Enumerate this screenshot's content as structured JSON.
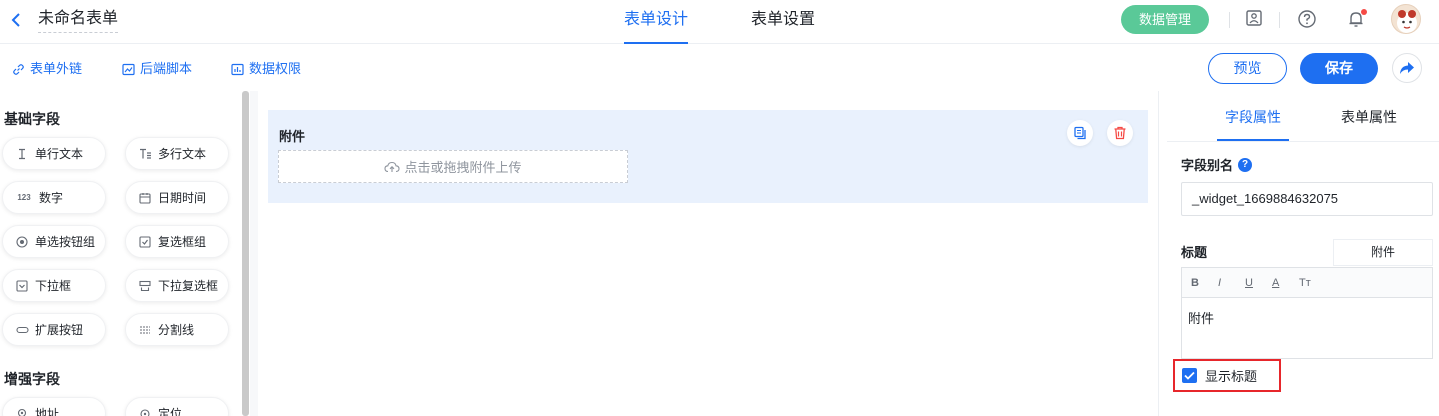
{
  "header": {
    "form_name": "未命名表单",
    "tabs": [
      {
        "label": "表单设计",
        "active": true
      },
      {
        "label": "表单设置",
        "active": false
      }
    ],
    "data_manage_label": "数据管理",
    "icons": [
      "contacts-icon",
      "help-icon",
      "bell-icon",
      "avatar"
    ]
  },
  "toolbar": {
    "links": [
      {
        "label": "表单外链",
        "icon": "link-icon"
      },
      {
        "label": "后端脚本",
        "icon": "script-icon"
      },
      {
        "label": "数据权限",
        "icon": "permission-icon"
      }
    ],
    "preview_label": "预览",
    "save_label": "保存"
  },
  "left_panel": {
    "basic_title": "基础字段",
    "basic_fields": [
      {
        "label": "单行文本",
        "icon": "text-cursor-icon"
      },
      {
        "label": "多行文本",
        "icon": "multiline-text-icon"
      },
      {
        "label": "数字",
        "icon": "number-icon"
      },
      {
        "label": "日期时间",
        "icon": "calendar-icon"
      },
      {
        "label": "单选按钮组",
        "icon": "radio-icon"
      },
      {
        "label": "复选框组",
        "icon": "checkbox-icon"
      },
      {
        "label": "下拉框",
        "icon": "dropdown-icon"
      },
      {
        "label": "下拉复选框",
        "icon": "dropdown-multi-icon"
      },
      {
        "label": "扩展按钮",
        "icon": "link-button-icon"
      },
      {
        "label": "分割线",
        "icon": "divider-icon"
      }
    ],
    "enhanced_title": "增强字段",
    "enhanced_fields": [
      {
        "label": "地址",
        "icon": "location-pin-icon"
      },
      {
        "label": "定位",
        "icon": "locate-icon"
      }
    ]
  },
  "canvas": {
    "widget_label": "附件",
    "upload_text": "点击或拖拽附件上传"
  },
  "right_panel": {
    "tabs": [
      {
        "label": "字段属性",
        "active": true
      },
      {
        "label": "表单属性",
        "active": false
      }
    ],
    "alias_label": "字段别名",
    "alias_value": "_widget_1669884632075",
    "title_label": "标题",
    "title_mini": "附件",
    "editor_buttons": [
      "B",
      "I",
      "U",
      "A",
      "Tт"
    ],
    "editor_content": "附件",
    "show_title_label": "显示标题",
    "show_title_checked": true
  },
  "colors": {
    "accent": "#1e6ff1",
    "data_button": "#5ac998",
    "widget_bg": "#e9f1fd",
    "delete": "#f54a45",
    "highlight_border": "#e7262b"
  }
}
